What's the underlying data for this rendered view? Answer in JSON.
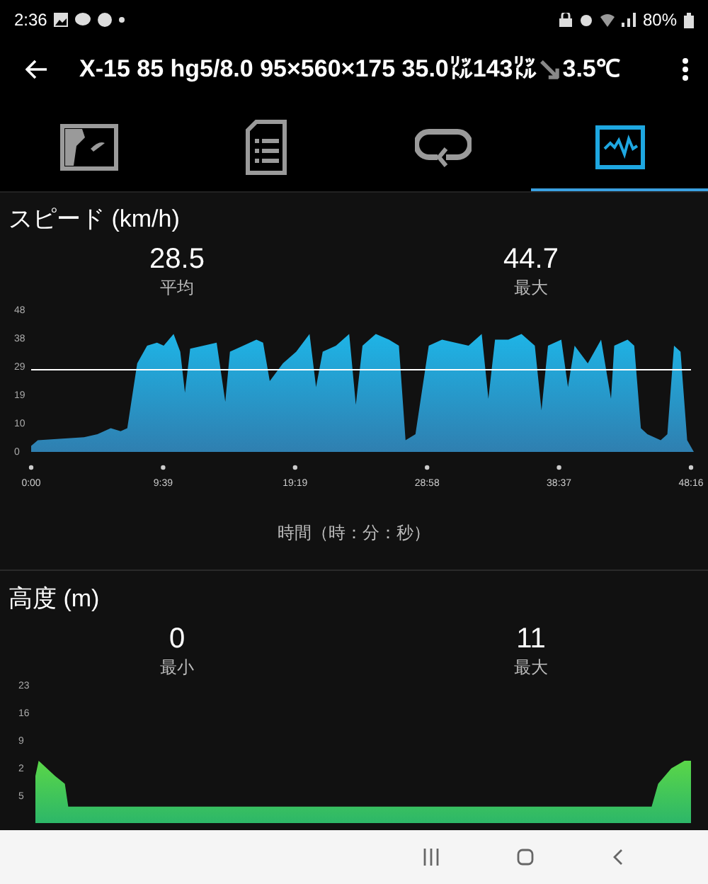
{
  "status_bar": {
    "time": "2:36",
    "battery": "80%"
  },
  "app_bar": {
    "title": "X-15 85 hg5/8.0 95×560×175 35.0㍑143㍑",
    "trend": "↘",
    "temperature": "3.5℃"
  },
  "tabs": [
    {
      "kind": "map",
      "selected": false
    },
    {
      "kind": "document",
      "selected": false
    },
    {
      "kind": "loop",
      "selected": false
    },
    {
      "kind": "chart",
      "selected": true
    }
  ],
  "speed": {
    "title": "スピード (km/h)",
    "stats": [
      {
        "value": "28.5",
        "label": "平均"
      },
      {
        "value": "44.7",
        "label": "最大"
      }
    ],
    "y_tick_labels": [
      "48",
      "38",
      "29",
      "19",
      "10",
      "0"
    ],
    "x_tick_labels": [
      "0:00",
      "9:39",
      "19:19",
      "28:58",
      "38:37",
      "48:16"
    ],
    "axis_caption": "時間（時：分：秒）"
  },
  "altitude": {
    "title": "高度 (m)",
    "stats": [
      {
        "value": "0",
        "label": "最小"
      },
      {
        "value": "11",
        "label": "最大"
      }
    ],
    "y_tick_labels": [
      "23",
      "16",
      "9",
      "2",
      "5"
    ]
  }
}
